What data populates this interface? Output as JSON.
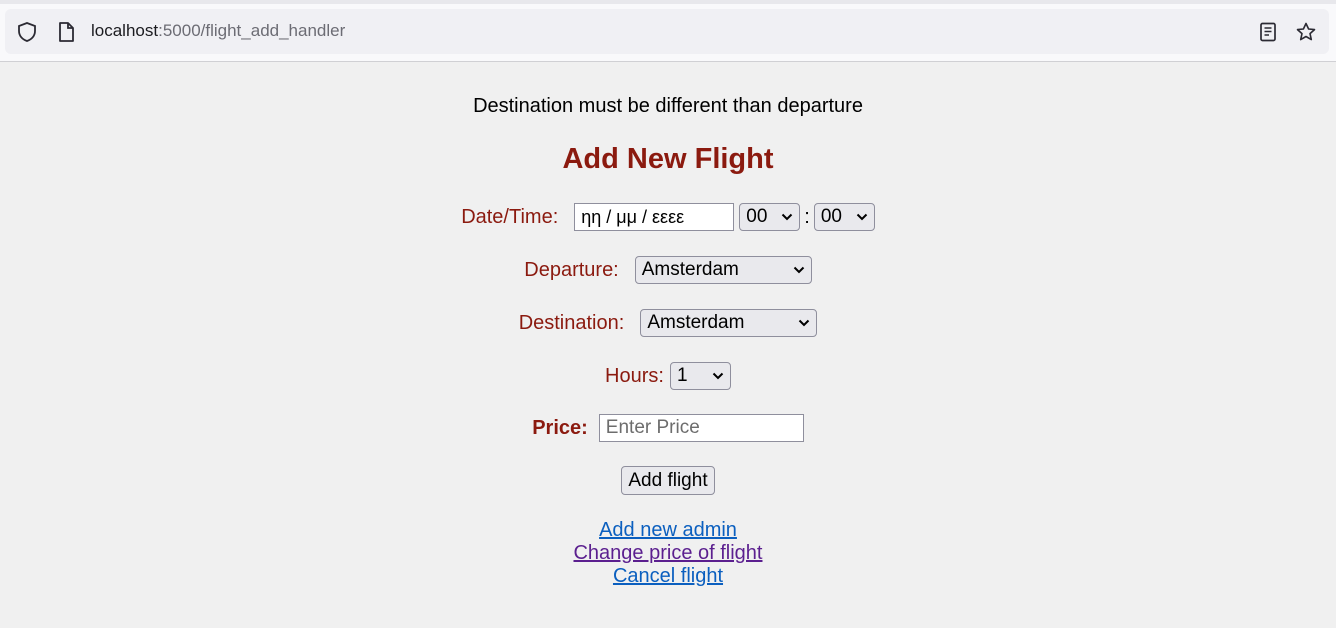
{
  "browser": {
    "url_host": "localhost",
    "url_path": ":5000/flight_add_handler"
  },
  "page": {
    "message": "Destination must be different than departure",
    "title": "Add New Flight"
  },
  "form": {
    "datetime": {
      "label": "Date/Time:",
      "date_placeholder": "ηη / μμ / εεεε",
      "hour": "00",
      "separator": ":",
      "minute": "00"
    },
    "departure": {
      "label": "Departure:",
      "value": "Amsterdam"
    },
    "destination": {
      "label": "Destination:",
      "value": "Amsterdam"
    },
    "hours": {
      "label": "Hours:",
      "value": "1"
    },
    "price": {
      "label": "Price:",
      "placeholder": "Enter Price"
    },
    "submit_label": "Add flight"
  },
  "links": {
    "add_admin": "Add new admin",
    "change_price": "Change price of flight",
    "cancel_flight": "Cancel flight"
  }
}
